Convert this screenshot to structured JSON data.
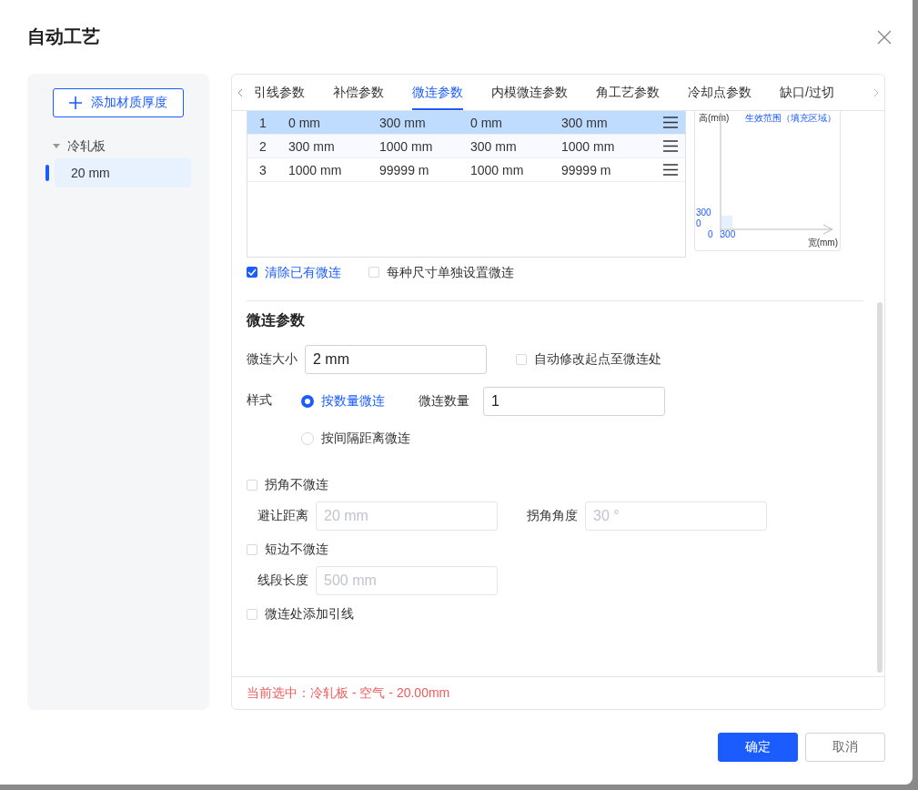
{
  "dialog": {
    "title": "自动工艺"
  },
  "sidebar": {
    "add_button": "添加材质厚度",
    "tree": [
      {
        "label": "冷轧板",
        "expanded": true,
        "children": [
          {
            "label": "20 mm",
            "selected": true
          }
        ]
      }
    ]
  },
  "tabs": [
    {
      "label": "引线参数",
      "selected": false
    },
    {
      "label": "补偿参数",
      "selected": false
    },
    {
      "label": "微连参数",
      "selected": true
    },
    {
      "label": "内模微连参数",
      "selected": false
    },
    {
      "label": "角工艺参数",
      "selected": false
    },
    {
      "label": "冷却点参数",
      "selected": false
    },
    {
      "label": "缺口/过切",
      "selected": false
    }
  ],
  "table": {
    "rows": [
      {
        "cells": [
          "1",
          "0 mm",
          "300 mm",
          "0 mm",
          "300 mm"
        ],
        "selected": true
      },
      {
        "cells": [
          "2",
          "300 mm",
          "1000 mm",
          "300 mm",
          "1000 mm"
        ],
        "selected": false
      },
      {
        "cells": [
          "3",
          "1000 mm",
          "99999 m",
          "1000 mm",
          "99999 m"
        ],
        "selected": false
      }
    ]
  },
  "preview": {
    "y_axis_label": "高(mm)",
    "legend": "生效范围（填充区域）",
    "y_tick_labels": [
      "300",
      "0"
    ],
    "x_tick_labels": [
      "0",
      "300"
    ],
    "x_axis_label": "宽(mm)"
  },
  "options": [
    {
      "label": "清除已有微连",
      "checked": true
    },
    {
      "label": "每种尺寸单独设置微连",
      "checked": false
    }
  ],
  "section": {
    "title": "微连参数",
    "size": {
      "label": "微连大小",
      "value": "2 mm"
    },
    "auto_start": {
      "label": "自动修改起点至微连处",
      "checked": false
    },
    "style": {
      "label": "样式",
      "options": [
        {
          "label": "按数量微连",
          "selected": true
        },
        {
          "label": "按间隔距离微连",
          "selected": false
        }
      ],
      "count": {
        "label": "微连数量",
        "value": "1"
      }
    },
    "groups": [
      {
        "label": "拐角不微连",
        "checked": false,
        "fields": [
          {
            "label": "避让距离",
            "placeholder": "20 mm"
          },
          {
            "label": "拐角角度",
            "placeholder": "30 °"
          }
        ]
      },
      {
        "label": "短边不微连",
        "checked": false,
        "fields": [
          {
            "label": "线段长度",
            "placeholder": "500 mm"
          }
        ]
      },
      {
        "label": "微连处添加引线",
        "checked": false
      }
    ]
  },
  "status": "当前选中：冷轧板 - 空气 - 20.00mm",
  "buttons": [
    {
      "label": "确定",
      "kind": "primary"
    },
    {
      "label": "取消",
      "kind": "secondary"
    }
  ]
}
